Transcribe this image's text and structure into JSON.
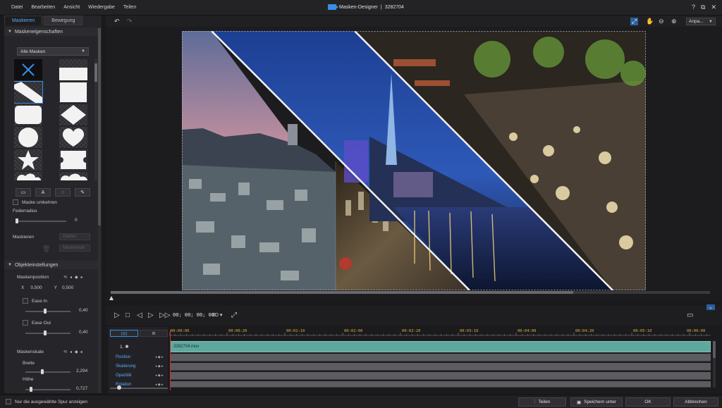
{
  "menu": {
    "items": [
      "Datei",
      "Bearbeiten",
      "Ansicht",
      "Wiedergabe",
      "Teilen"
    ]
  },
  "window": {
    "title": "Masken-Designer",
    "separator": "|",
    "file_id": "3282704",
    "controls": [
      "?",
      "⧉",
      "✕"
    ]
  },
  "tabs": {
    "maskieren": "Maskieren",
    "bewegung": "Bewegung"
  },
  "mask_properties": {
    "header": "Maskeneigenschaften",
    "dropdown_value": "Alle Masken",
    "invert_label": "Maske umkehren",
    "feather_label": "Federradius",
    "feather_value": "0",
    "masking_label": "Maskieren",
    "masking_dropdown": "Glatten",
    "clear_label": "Maskentran"
  },
  "object_settings": {
    "header": "Objekteinstellungen",
    "mask_position_label": "Maskenposition",
    "x_label": "X",
    "x_value": "0,500",
    "y_label": "Y",
    "y_value": "0,500",
    "ease_in_label": "Ease In",
    "ease_in_value": "0,40",
    "ease_out_label": "Ease Out",
    "ease_out_value": "0,40",
    "mask_scale_label": "Maskenskale",
    "width_label": "Breite",
    "width_value": "2,294",
    "height_label": "Höhe",
    "height_value": "0,727"
  },
  "toolbar": {
    "zoom_value": "Anpa..."
  },
  "playback": {
    "timecode": "00; 00; 00; 00",
    "mode_3d": "3D"
  },
  "timeline": {
    "ruler_labels": [
      "00:00:00",
      "00:00:20",
      "00:01:10",
      "00:02:00",
      "00:02:20",
      "00:03:10",
      "00:04:00",
      "00:04:20",
      "00:05:10",
      "00:06:00"
    ],
    "track_name": "1. ✱",
    "clip_name": "3282704.mov",
    "properties": [
      "Position",
      "Skalierung",
      "Opazität",
      "Rotation"
    ]
  },
  "bottom": {
    "only_selected_label": "Nur die ausgewählte Spur anzeigen",
    "teilen": "Teilen",
    "speichern_unter": "Speichern unter",
    "ok": "OK",
    "abbrechen": "Abbrechen"
  },
  "colors": {
    "accent": "#3a8ee6",
    "clip": "#5fa89e",
    "playhead": "#d03030",
    "ruler": "#d9b040"
  }
}
